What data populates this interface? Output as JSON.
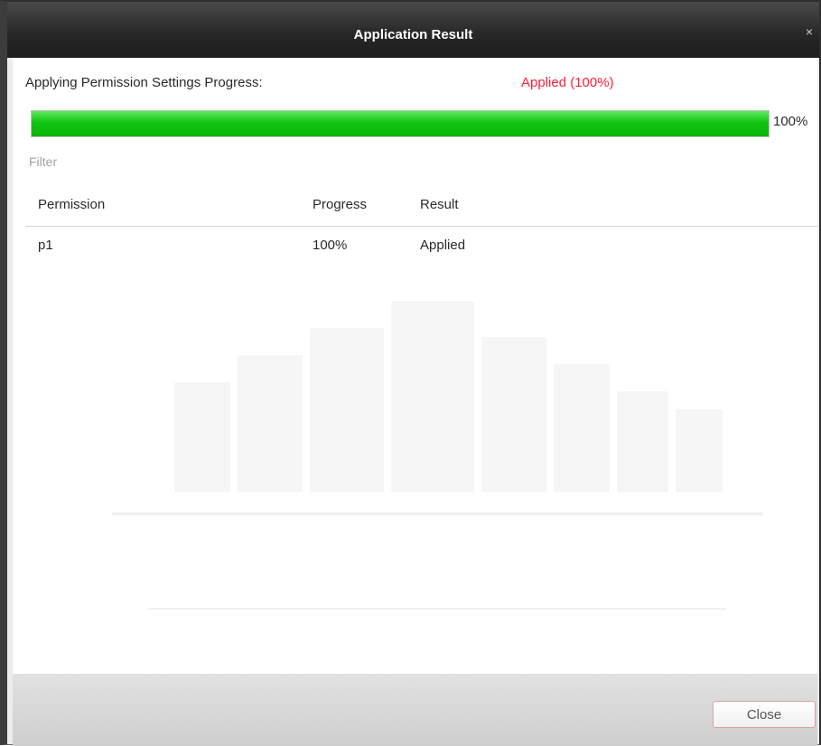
{
  "dialog": {
    "title": "Application Result",
    "close_icon": "close-icon"
  },
  "progress": {
    "label": "Applying Permission Settings Progress:",
    "status": "Applied (100%)",
    "percent_text": "100%",
    "value": 1.0,
    "fill_color": "#11c411",
    "status_color": "#ff1f3a"
  },
  "filter": {
    "placeholder": "Filter"
  },
  "table": {
    "columns": [
      "Permission",
      "Progress",
      "Result"
    ],
    "rows": [
      {
        "permission": "p1",
        "progress": "100%",
        "result": "Applied"
      }
    ]
  },
  "footer": {
    "close_label": "Close"
  }
}
